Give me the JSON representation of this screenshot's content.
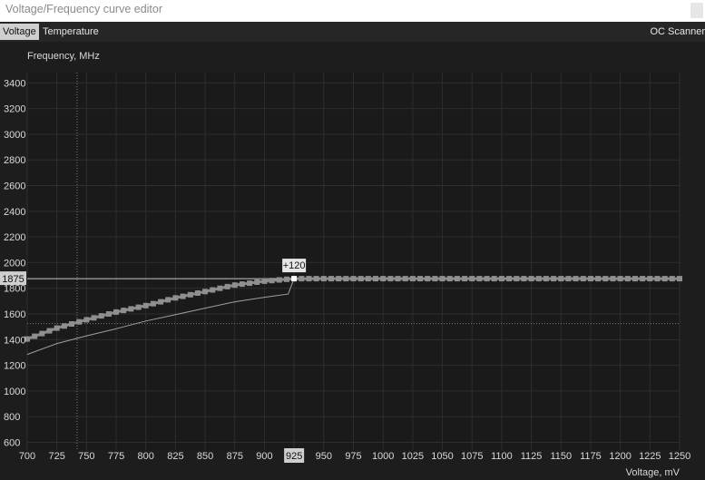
{
  "window": {
    "title": "Voltage/Frequency curve editor"
  },
  "tabs": [
    {
      "label": "Voltage",
      "active": true
    },
    {
      "label": "Temperature",
      "active": false
    }
  ],
  "oc_scanner_label": "OC Scanner",
  "colors": {
    "background": "#1d1d1d",
    "plot_area": "#1a1a1a",
    "grid": "#2e2e2e",
    "axis_text": "#d9d9d9",
    "curve": "#8c8c8c",
    "base_curve": "#a0a0a0",
    "highlight": "#ffffff"
  },
  "chart_data": {
    "type": "line",
    "title": "",
    "xlabel": "Voltage, mV",
    "ylabel": "Frequency, MHz",
    "xlim": [
      700,
      1250
    ],
    "ylim": [
      540,
      3480
    ],
    "x_ticks": [
      700,
      725,
      750,
      775,
      800,
      825,
      850,
      875,
      900,
      925,
      950,
      975,
      1000,
      1025,
      1050,
      1075,
      1100,
      1125,
      1150,
      1175,
      1200,
      1225,
      1250
    ],
    "y_ticks": [
      600,
      800,
      1000,
      1200,
      1400,
      1600,
      1800,
      2000,
      2200,
      2400,
      2600,
      2800,
      3000,
      3200,
      3400
    ],
    "grid": true,
    "selected_voltage": 925,
    "selected_frequency": 1875,
    "selected_frequency_label": "1875",
    "offset_label": "+120",
    "guide_lines": {
      "voltage": 742,
      "frequency": 1525
    },
    "series": [
      {
        "role": "curve",
        "x": [
          700,
          725,
          750,
          775,
          800,
          825,
          850,
          875,
          900,
          925,
          950,
          1000,
          1050,
          1100,
          1150,
          1200,
          1250
        ],
        "y": [
          1405,
          1490,
          1555,
          1615,
          1665,
          1725,
          1775,
          1825,
          1855,
          1875,
          1875,
          1875,
          1875,
          1875,
          1875,
          1875,
          1875
        ]
      },
      {
        "role": "base",
        "x": [
          700,
          725,
          750,
          775,
          800,
          825,
          850,
          875,
          900,
          920,
          925
        ],
        "y": [
          1285,
          1370,
          1430,
          1485,
          1545,
          1595,
          1645,
          1695,
          1730,
          1755,
          1875
        ]
      }
    ]
  }
}
